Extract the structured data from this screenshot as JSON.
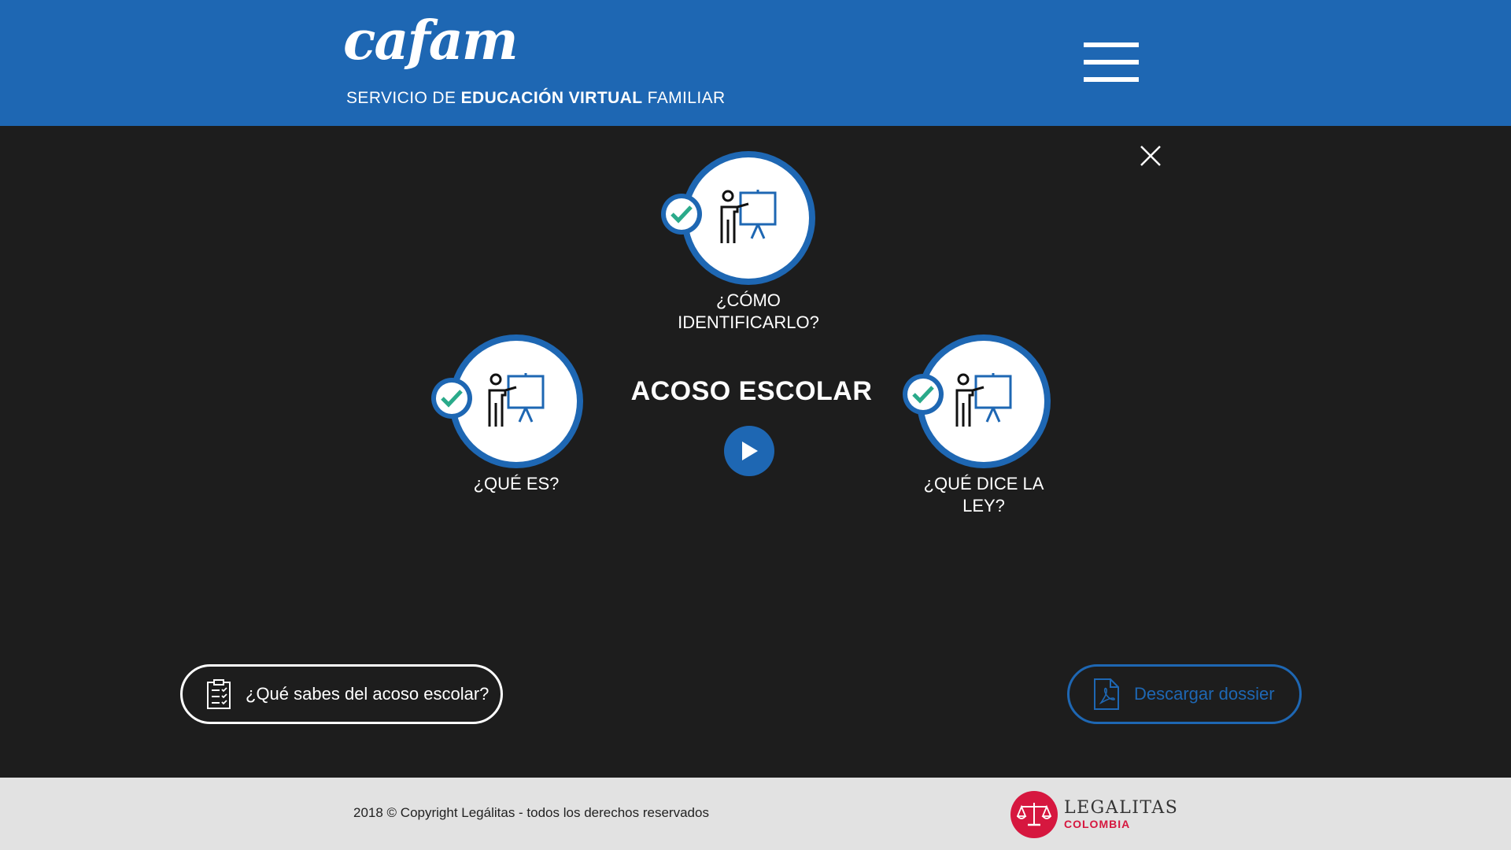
{
  "header": {
    "logo_text": "cafam",
    "subtitle_prefix": "SERVICIO DE ",
    "subtitle_bold": "EDUCACIÓN VIRTUAL",
    "subtitle_suffix": " FAMILIAR",
    "menu_icon": "hamburger-icon"
  },
  "modal": {
    "close_icon": "close-icon",
    "center_title": "ACOSO ESCOLAR",
    "play_icon": "play-icon",
    "topics": [
      {
        "label_line1": "¿CÓMO",
        "label_line2": "IDENTIFICARLO?",
        "icon": "presenter-icon",
        "completed": true
      },
      {
        "label_line1": "¿QUÉ ES?",
        "label_line2": "",
        "icon": "presenter-icon",
        "completed": true
      },
      {
        "label_line1": "¿QUÉ DICE LA LEY?",
        "label_line2": "",
        "icon": "presenter-icon",
        "completed": true
      }
    ]
  },
  "actions": {
    "quiz_label": "¿Qué sabes del acoso escolar?",
    "quiz_icon": "clipboard-checklist-icon",
    "dossier_label": "Descargar dossier",
    "dossier_icon": "pdf-file-icon"
  },
  "footer": {
    "copyright": "2018 © Copyright Legálitas - todos los derechos reservados",
    "brand_name": "LEGALITAS",
    "brand_country": "COLOMBIA",
    "brand_icon": "scales-icon"
  },
  "colors": {
    "primary_blue": "#1e67b3",
    "background": "#1d1d1d",
    "check_green": "#2aaa8a",
    "brand_red": "#d6173f",
    "footer_bg": "#e2e2e2"
  }
}
